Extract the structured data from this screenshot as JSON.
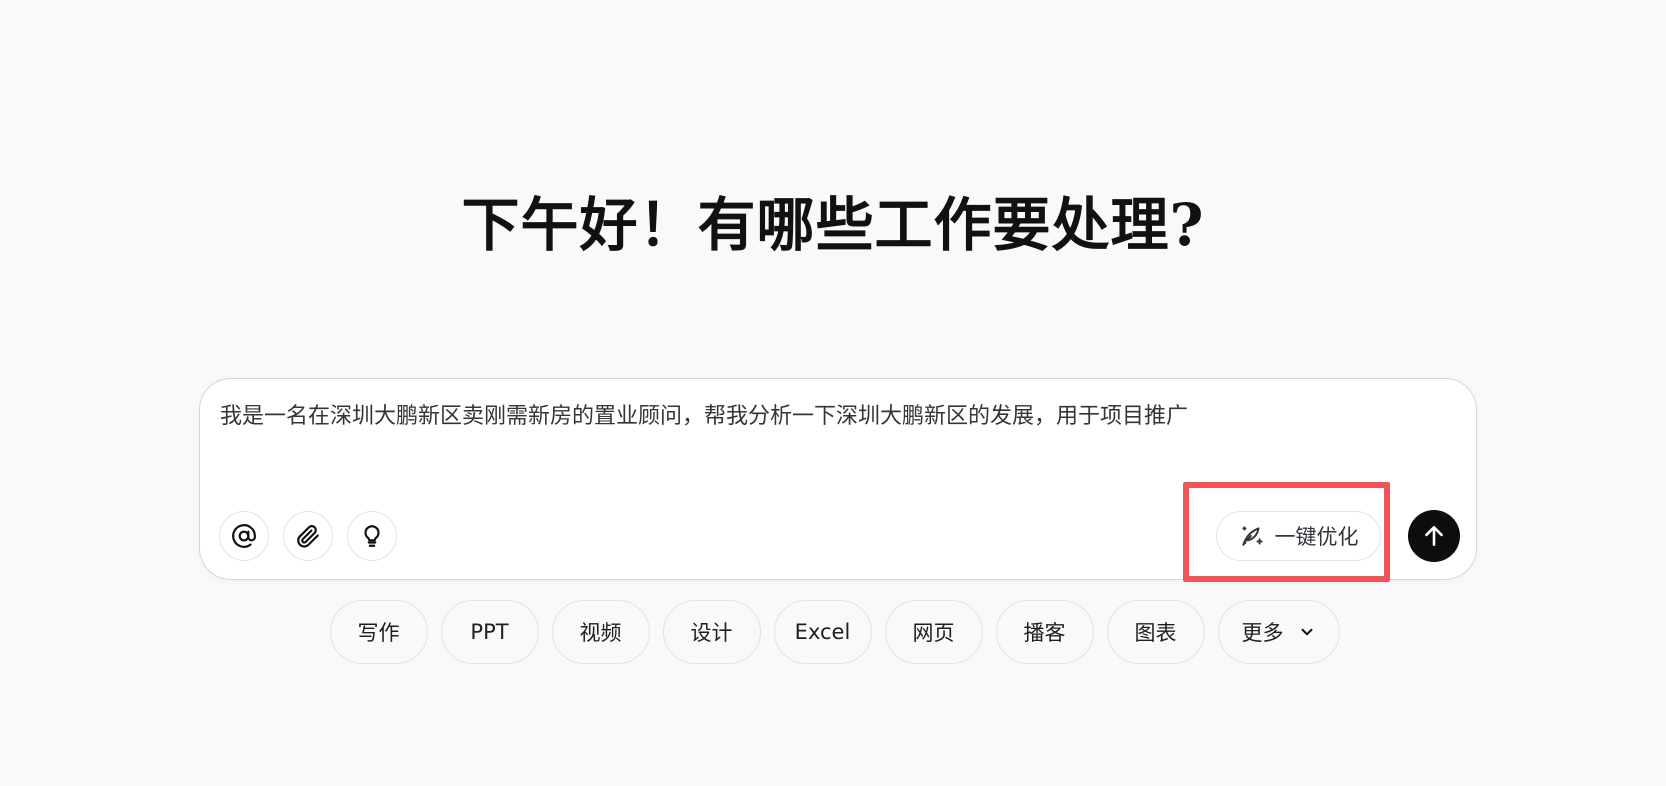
{
  "greeting": "下午好！有哪些工作要处理?",
  "composer": {
    "prompt_text": "我是一名在深圳大鹏新区卖刚需新房的置业顾问，帮我分析一下深圳大鹏新区的发展，用于项目推广",
    "tools": [
      {
        "name": "mention",
        "icon": "at-icon"
      },
      {
        "name": "attach",
        "icon": "paperclip-icon"
      },
      {
        "name": "inspire",
        "icon": "lightbulb-icon"
      }
    ],
    "optimize_label": "一键优化",
    "optimize_icon": "quill-sparkle-icon",
    "send_icon": "arrow-up-icon",
    "highlight_color": "#f0555a"
  },
  "chips": {
    "items": [
      "写作",
      "PPT",
      "视频",
      "设计",
      "Excel",
      "网页",
      "播客",
      "图表"
    ],
    "more_label": "更多",
    "more_icon": "chevron-down-icon"
  }
}
